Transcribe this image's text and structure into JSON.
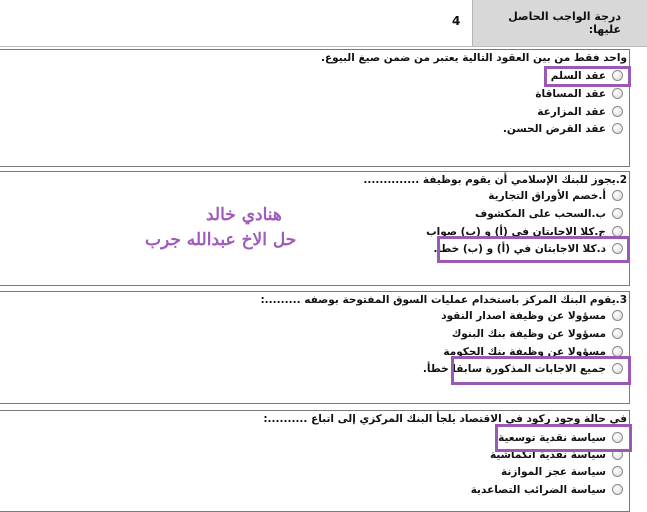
{
  "header": {
    "grade_label": "درجة الواجب الحاصل عليها:",
    "grade_value": "4"
  },
  "questions": [
    {
      "title": "واحد فقط من بين العقود التالية يعتبر من ضمن صيغ البيوع.",
      "options": [
        "عقد السلم",
        "عقد المساقاة",
        "عقد المزارعة",
        "عقد القرض الحسن."
      ]
    },
    {
      "title": "2.يجوز للبنك الإسلامي أن يقوم بوظيفة ..............",
      "options": [
        "أ.خصم الأوراق التجارية",
        "ب.السحب على المكشوف",
        "ج.كلا الاجابتان في (أ) و (ب) صواب",
        "د.كلا الاجابتان في (أ) و (ب) خطأ."
      ]
    },
    {
      "title": "3.يقوم البنك المركز باستخدام عمليات السوق المفتوحة بوصفه .........:",
      "options": [
        "مسؤولا عن وظيفة اصدار النقود",
        "مسؤولا عن وظيفة بنك البنوك",
        "مسؤولا عن وظيفة بنك الحكومة",
        "جميع الاجابات المذكورة سابقا خطأ."
      ]
    },
    {
      "title": "في حالة وجود ركود في الاقتصاد يلجأ البنك المركزي إلى اتباع ..........:",
      "options": [
        "سياسة نقدية توسعية",
        "سياسة نقدية انكماشية",
        "سياسة عجز الموازنة",
        "سياسة الضرائب التصاعدية"
      ]
    }
  ],
  "annotation": {
    "line1": "هنادي خالد",
    "line2": "حل الاخ عبدالله جرب",
    "color": "#9b59b6"
  }
}
